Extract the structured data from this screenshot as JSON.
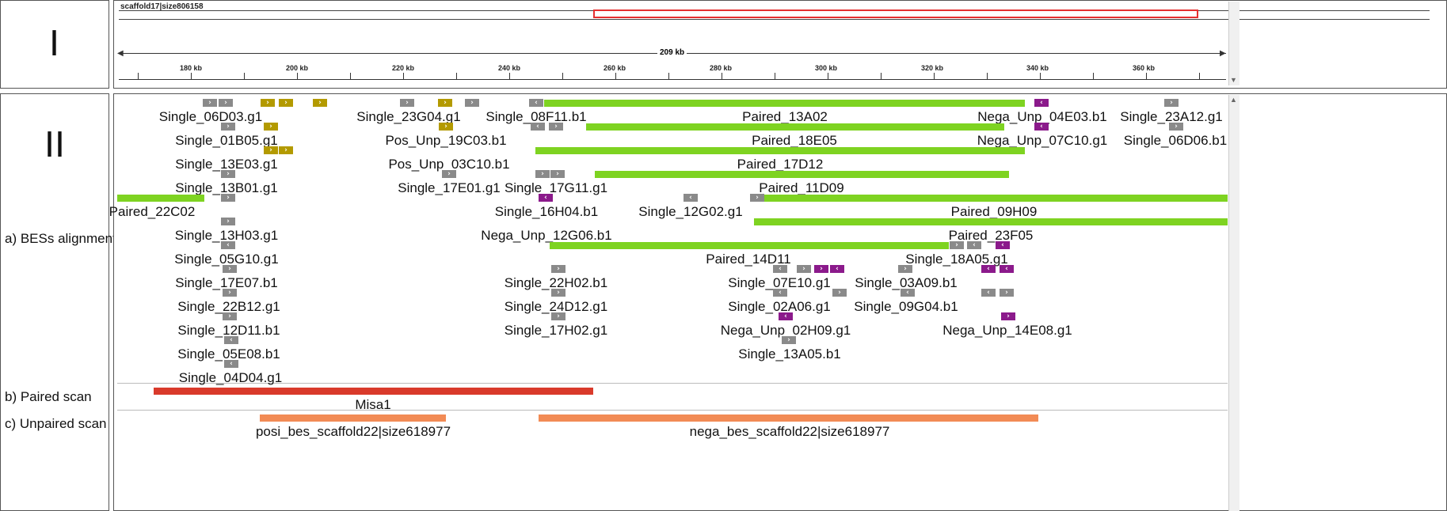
{
  "ruler": {
    "chromosome": "scaffold17|size806158",
    "span": "209 kb",
    "ticks": [
      "180 kb",
      "200 kb",
      "220 kb",
      "240 kb",
      "260 kb",
      "280 kb",
      "300 kb",
      "320 kb",
      "340 kb",
      "360 kb"
    ]
  },
  "panels": {
    "first": "I",
    "second": "II"
  },
  "tracks": {
    "bes": "a) BESs alignment",
    "paired": "b) Paired scan",
    "unpaired": "c) Unpaired scan"
  },
  "colors": {
    "paired": "#7ed321",
    "single": "#8a8a8a",
    "pos_unp": "#b39a00",
    "nega_unp": "#8b1a8b",
    "misa": "#d93a2b",
    "unpaired_scan": "#f28b55",
    "region_box": "#e53030"
  },
  "bes_labels": [
    "Single_06D03.g1",
    "Single_23G04.g1",
    "Single_08F11.b1",
    "Paired_13A02",
    "Nega_Unp_04E03.b1",
    "Single_23A12.g1",
    "Single_01B05.g1",
    "Pos_Unp_19C03.b1",
    "Paired_18E05",
    "Nega_Unp_07C10.g1",
    "Single_06D06.b1",
    "Single_13E03.g1",
    "Pos_Unp_03C10.b1",
    "Paired_17D12",
    "Single_13B01.g1",
    "Single_17E01.g1",
    "Single_17G11.g1",
    "Paired_11D09",
    "Paired_22C02",
    "Single_16H04.b1",
    "Single_12G02.g1",
    "Paired_09H09",
    "Single_13H03.g1",
    "Nega_Unp_12G06.b1",
    "Paired_23F05",
    "Single_05G10.g1",
    "Paired_14D11",
    "Single_18A05.g1",
    "Single_17E07.b1",
    "Single_22H02.b1",
    "Single_07E10.g1",
    "Single_03A09.b1",
    "Single_22B12.g1",
    "Single_24D12.g1",
    "Single_02A06.g1",
    "Single_09G04.b1",
    "Single_12D11.b1",
    "Single_17H02.g1",
    "Nega_Unp_02H09.g1",
    "Nega_Unp_14E08.g1",
    "Single_05E08.b1",
    "Single_13A05.b1",
    "Single_04D04.g1"
  ],
  "misa": {
    "label": "Misa1"
  },
  "unpaired_scan": {
    "posi_label": "posi_bes_scaffold22|size618977",
    "nega_label": "nega_bes_scaffold22|size618977"
  }
}
